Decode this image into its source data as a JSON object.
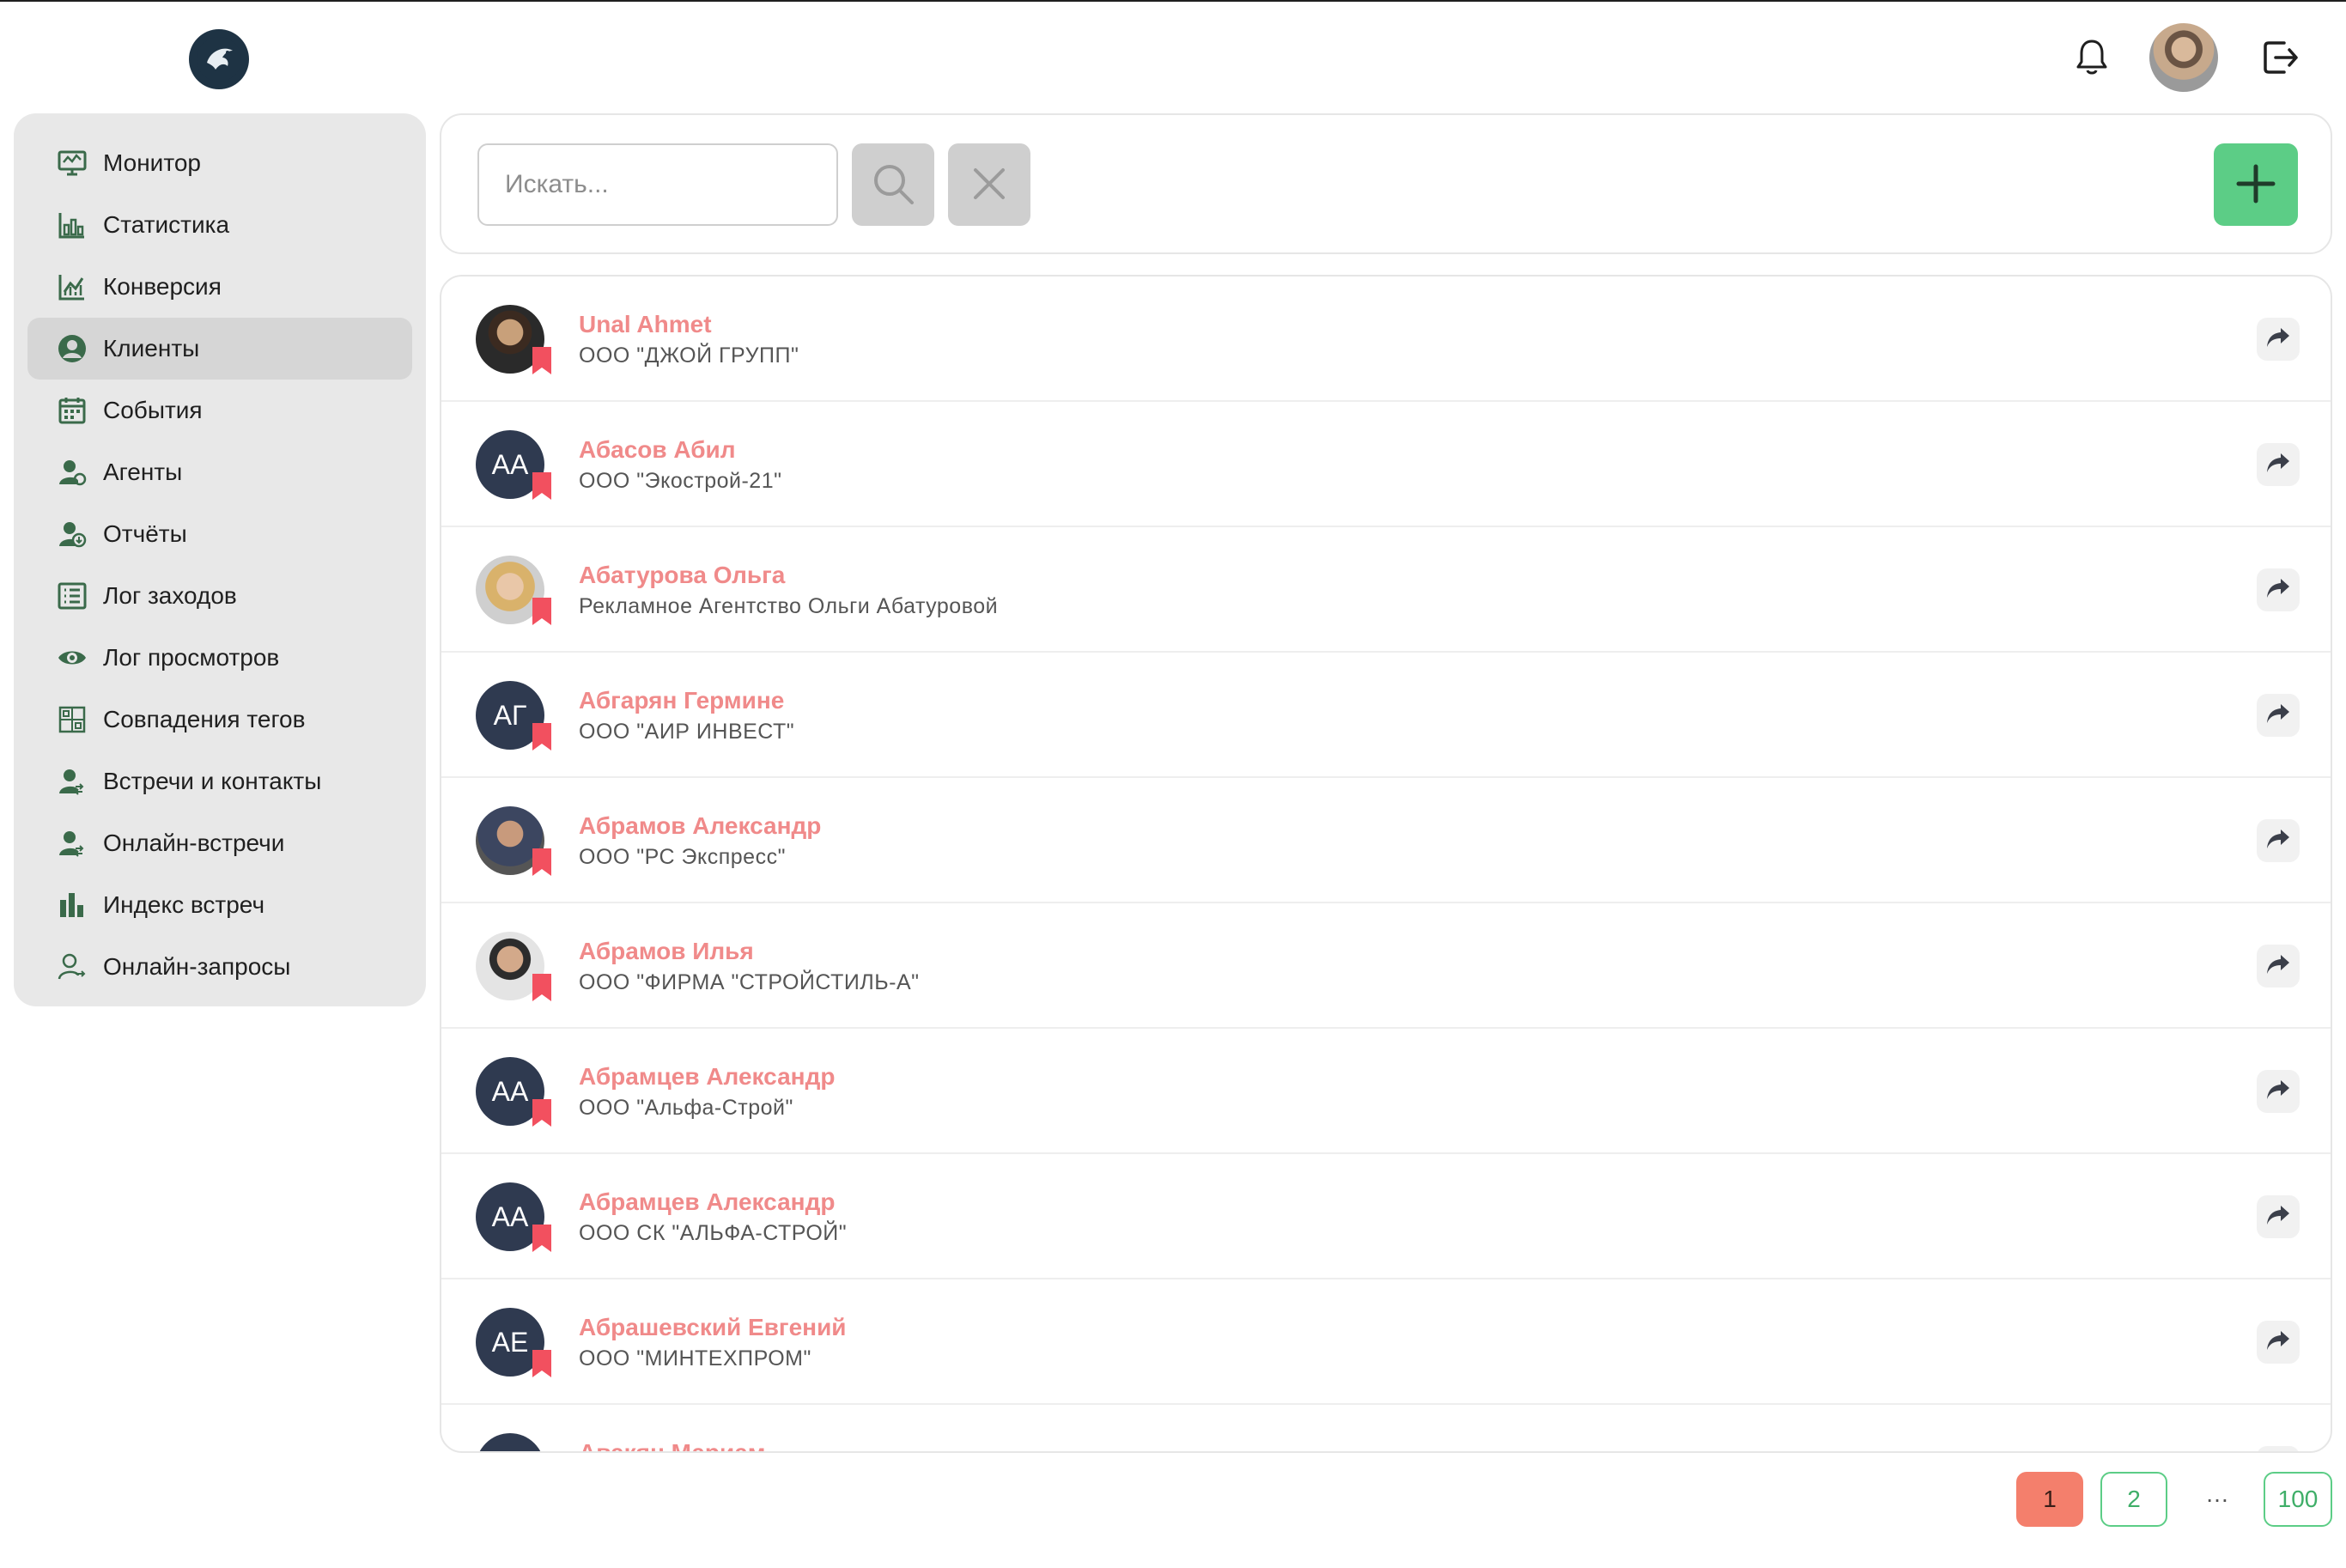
{
  "header": {
    "logo_icon": "eagle-logo-icon",
    "notifications_icon": "bell-icon",
    "logout_icon": "logout-icon"
  },
  "sidebar": {
    "items": [
      {
        "label": "Монитор",
        "icon": "monitor-icon",
        "active": false
      },
      {
        "label": "Статистика",
        "icon": "statistics-icon",
        "active": false
      },
      {
        "label": "Конверсия",
        "icon": "conversion-icon",
        "active": false
      },
      {
        "label": "Клиенты",
        "icon": "user-circle-icon",
        "active": true
      },
      {
        "label": "События",
        "icon": "calendar-icon",
        "active": false
      },
      {
        "label": "Агенты",
        "icon": "agents-icon",
        "active": false
      },
      {
        "label": "Отчёты",
        "icon": "reports-icon",
        "active": false
      },
      {
        "label": "Лог заходов",
        "icon": "list-icon",
        "active": false
      },
      {
        "label": "Лог просмотров",
        "icon": "eye-icon",
        "active": false
      },
      {
        "label": "Совпадения тегов",
        "icon": "tags-match-icon",
        "active": false
      },
      {
        "label": "Встречи и контакты",
        "icon": "meetings-icon",
        "active": false
      },
      {
        "label": "Онлайн-встречи",
        "icon": "online-meetings-icon",
        "active": false
      },
      {
        "label": "Индекс встреч",
        "icon": "bar-chart-icon",
        "active": false
      },
      {
        "label": "Онлайн-запросы",
        "icon": "online-requests-icon",
        "active": false
      }
    ]
  },
  "search": {
    "placeholder": "Искать...",
    "value": "",
    "search_icon": "search-icon",
    "clear_icon": "close-icon",
    "add_icon": "plus-icon"
  },
  "clients": [
    {
      "name": "Unal Ahmet",
      "company": "ООО \"ДЖОЙ ГРУПП\"",
      "initials": "",
      "photo": true
    },
    {
      "name": "Абасов Абил",
      "company": "ООО \"Экострой-21\"",
      "initials": "АА",
      "photo": false
    },
    {
      "name": "Абатурова Ольга",
      "company": "Рекламное Агентство Ольги Абатуровой",
      "initials": "",
      "photo": true
    },
    {
      "name": "Абгарян Гермине",
      "company": "ООО \"АИР ИНВЕСТ\"",
      "initials": "АГ",
      "photo": false
    },
    {
      "name": "Абрамов Александр",
      "company": "ООО \"РС Экспресс\"",
      "initials": "",
      "photo": true
    },
    {
      "name": "Абрамов Илья",
      "company": "ООО \"ФИРМА \"СТРОЙСТИЛЬ-А\"",
      "initials": "",
      "photo": true
    },
    {
      "name": "Абрамцев Александр",
      "company": "ООО \"Альфа-Строй\"",
      "initials": "АА",
      "photo": false
    },
    {
      "name": "Абрамцев Александр",
      "company": "ООО СК \"АЛЬФА-СТРОЙ\"",
      "initials": "АА",
      "photo": false
    },
    {
      "name": "Абрашевский Евгений",
      "company": "ООО \"МИНТЕХПРОМ\"",
      "initials": "АЕ",
      "photo": false
    },
    {
      "name": "Авакян Мариам",
      "company": "",
      "initials": "",
      "photo": false
    }
  ],
  "pagination": {
    "pages": [
      "1",
      "2",
      "…",
      "100"
    ],
    "current": "1"
  },
  "colors": {
    "accent_green": "#5ccd86",
    "client_name": "#f08a8a",
    "bookmark": "#f2505f",
    "active_page": "#f47f6c",
    "avatar_bg": "#2f3a50"
  }
}
